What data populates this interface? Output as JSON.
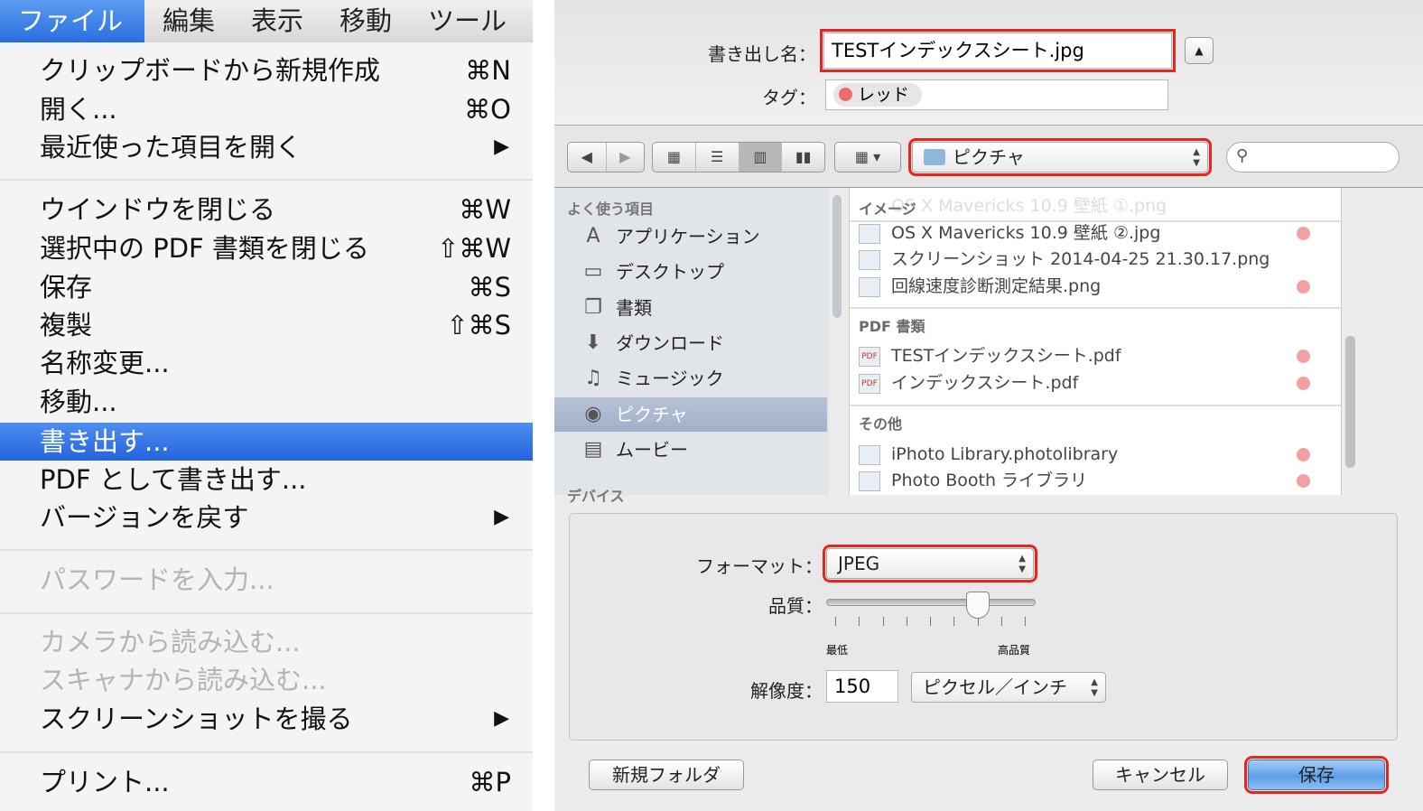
{
  "menubar": {
    "items": [
      "ファイル",
      "編集",
      "表示",
      "移動",
      "ツール"
    ],
    "active": 0
  },
  "file_menu": {
    "items": [
      {
        "label": "クリップボードから新規作成",
        "shortcut": "⌘N"
      },
      {
        "label": "開く...",
        "shortcut": "⌘O"
      },
      {
        "label": "最近使った項目を開く",
        "submenu": "▶"
      },
      {
        "label": "ウインドウを閉じる",
        "shortcut": "⌘W"
      },
      {
        "label": "選択中の PDF 書類を閉じる",
        "shortcut": "⇧⌘W"
      },
      {
        "label": "保存",
        "shortcut": "⌘S"
      },
      {
        "label": "複製",
        "shortcut": "⇧⌘S"
      },
      {
        "label": "名称変更..."
      },
      {
        "label": "移動..."
      },
      {
        "label": "書き出す...",
        "highlighted": true
      },
      {
        "label": "PDF として書き出す..."
      },
      {
        "label": "バージョンを戻す",
        "submenu": "▶"
      },
      {
        "label": "パスワードを入力...",
        "disabled": true
      },
      {
        "label": "カメラから読み込む...",
        "disabled": true
      },
      {
        "label": "スキャナから読み込む...",
        "disabled": true
      },
      {
        "label": "スクリーンショットを撮る",
        "submenu": "▶"
      },
      {
        "label": "プリント...",
        "shortcut": "⌘P"
      }
    ]
  },
  "dialog": {
    "export_name_label": "書き出し名：",
    "export_name": "TESTインデックスシート.jpg",
    "tags_label": "タグ：",
    "tag": "レッド",
    "tag_color": "#f06a6a",
    "location": "ピクチャ",
    "search_placeholder": "",
    "sidebar": {
      "header": "よく使う項目",
      "items": [
        "アプリケーション",
        "デスクトップ",
        "書類",
        "ダウンロード",
        "ミュージック",
        "ピクチャ",
        "ムービー"
      ],
      "selected": "ピクチャ",
      "next_header": "デバイス"
    },
    "files": {
      "group_image": "イメージ",
      "image_hidden": "OS X Mavericks 10.9 壁紙 ①.png",
      "images": [
        "OS X Mavericks 10.9 壁紙 ②.jpg",
        "スクリーンショット 2014-04-25 21.30.17.png",
        "回線速度診断測定結果.png"
      ],
      "group_pdf": "PDF 書類",
      "pdfs": [
        "TESTインデックスシート.pdf",
        "インデックスシート.pdf"
      ],
      "group_other": "その他",
      "others": [
        "iPhoto Library.photolibrary",
        "Photo Booth ライブラリ"
      ]
    },
    "format_label": "フォーマット：",
    "format": "JPEG",
    "quality_label": "品質：",
    "quality_fraction": 0.75,
    "quality_min": "最低",
    "quality_max": "高品質",
    "resolution_label": "解像度：",
    "resolution": "150",
    "resolution_unit": "ピクセル／インチ",
    "new_folder": "新規フォルダ",
    "cancel": "キャンセル",
    "save": "保存",
    "highlight_color": "#e8251d"
  }
}
